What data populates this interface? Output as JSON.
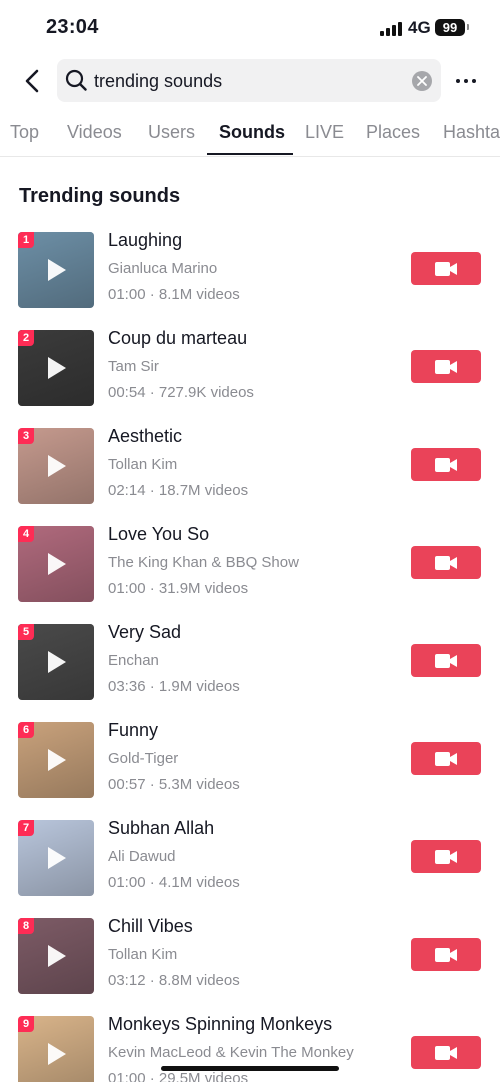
{
  "status": {
    "time": "23:04",
    "network": "4G",
    "battery": "99"
  },
  "search": {
    "query": "trending sounds"
  },
  "tabs": [
    {
      "label": "Top"
    },
    {
      "label": "Videos"
    },
    {
      "label": "Users"
    },
    {
      "label": "Sounds",
      "active": true
    },
    {
      "label": "LIVE"
    },
    {
      "label": "Places"
    },
    {
      "label": "Hashta"
    }
  ],
  "section": {
    "title": "Trending sounds"
  },
  "sounds": [
    {
      "rank": "1",
      "title": "Laughing",
      "artist": "Gianluca Marino",
      "meta": "01:00 · 8.1M videos",
      "thumb_color": "#6d8fa6"
    },
    {
      "rank": "2",
      "title": "Coup du marteau",
      "artist": "Tam Sir",
      "meta": "00:54 · 727.9K videos",
      "thumb_color": "#3b3b3b"
    },
    {
      "rank": "3",
      "title": "Aesthetic",
      "artist": "Tollan Kim",
      "meta": "02:14 · 18.7M videos",
      "thumb_color": "#c59a8e"
    },
    {
      "rank": "4",
      "title": "Love You So",
      "artist": "The King Khan & BBQ Show",
      "meta": "01:00 · 31.9M videos",
      "thumb_color": "#b06a7d"
    },
    {
      "rank": "5",
      "title": "Very Sad",
      "artist": "Enchan",
      "meta": "03:36 · 1.9M videos",
      "thumb_color": "#4a4a4a"
    },
    {
      "rank": "6",
      "title": "Funny",
      "artist": "Gold-Tiger",
      "meta": "00:57 · 5.3M videos",
      "thumb_color": "#c9a27c"
    },
    {
      "rank": "7",
      "title": "Subhan Allah",
      "artist": "Ali Dawud",
      "meta": "01:00 · 4.1M videos",
      "thumb_color": "#b9c6dc"
    },
    {
      "rank": "8",
      "title": "Chill Vibes",
      "artist": "Tollan Kim",
      "meta": "03:12 · 8.8M videos",
      "thumb_color": "#7d5b66"
    },
    {
      "rank": "9",
      "title": "Monkeys Spinning Monkeys",
      "artist": "Kevin MacLeod & Kevin The Monkey",
      "meta": "01:00 · 29.5M videos",
      "thumb_color": "#d9b48a"
    }
  ],
  "colors": {
    "accent": "#fe2c55",
    "record_button": "#ea4359",
    "secondary_text": "#8a8b91"
  }
}
